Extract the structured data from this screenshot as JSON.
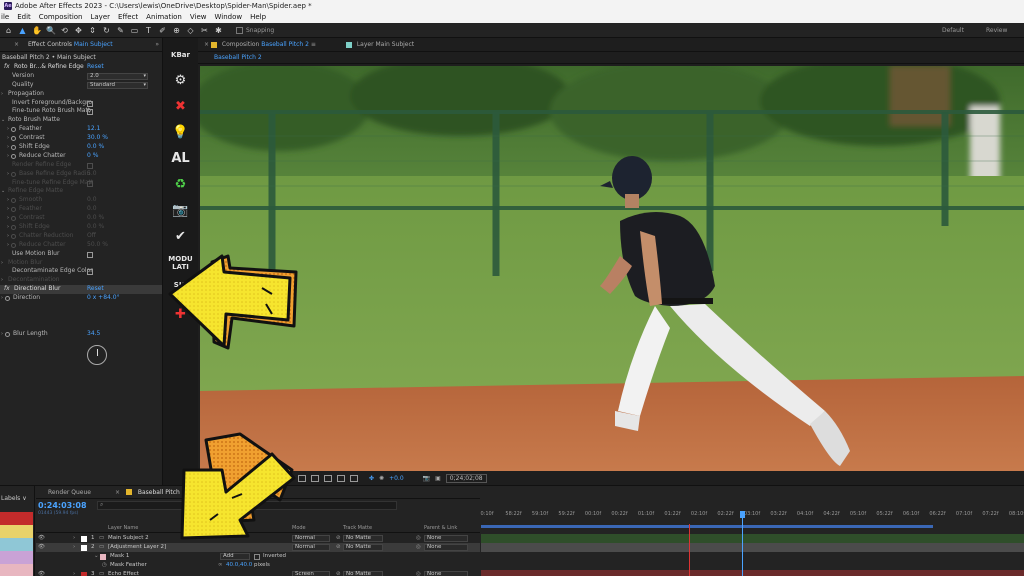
{
  "app": {
    "title": "Adobe After Effects 2023 - C:\\Users\\lewis\\OneDrive\\Desktop\\Spider-Man\\Spider.aep *",
    "logo": "Ae"
  },
  "menu": [
    "ile",
    "Edit",
    "Composition",
    "Layer",
    "Effect",
    "Animation",
    "View",
    "Window",
    "Help"
  ],
  "toolbar": {
    "tools": [
      "home-icon",
      "selection-arrow-icon",
      "hand-icon",
      "zoom-icon",
      "orbit-icon",
      "pan-icon",
      "dolly-icon",
      "rotate-icon",
      "pen-icon",
      "shape-icon",
      "type-icon",
      "brush-icon",
      "clone-stamp-icon",
      "eraser-icon",
      "roto-brush-icon",
      "puppet-pin-icon"
    ],
    "tool_glyphs": [
      "⌂",
      "▲",
      "✋",
      "🔍",
      "⟲",
      "✥",
      "⇕",
      "↻",
      "✎",
      "▭",
      "T",
      "✐",
      "⊕",
      "◇",
      "✂",
      "✱"
    ],
    "snapping_label": "Snapping",
    "workspaces": [
      "Default",
      "Review"
    ]
  },
  "effect_controls": {
    "tab_prefix": "Effect Controls",
    "tab_subject": "Main Subject",
    "subtitle": "Baseball Pitch 2 • Main Subject",
    "rows": [
      {
        "type": "fx",
        "label": "Roto Br...& Refine Edge",
        "reset": "Reset"
      },
      {
        "type": "dropdown",
        "indent": 12,
        "label": "Version",
        "value": "2.0"
      },
      {
        "type": "dropdown",
        "indent": 12,
        "label": "Quality",
        "value": "Standard"
      },
      {
        "type": "group",
        "indent": 6,
        "label": "Propagation"
      },
      {
        "type": "check",
        "indent": 12,
        "label": "Invert Foreground/Backgro",
        "checked": false
      },
      {
        "type": "check",
        "indent": 12,
        "label": "Fine-tune Roto Brush Matt",
        "checked": true
      },
      {
        "type": "group-open",
        "indent": 6,
        "label": "Roto Brush Matte"
      },
      {
        "type": "param",
        "indent": 18,
        "label": "Feather",
        "value": "12.1"
      },
      {
        "type": "param",
        "indent": 18,
        "label": "Contrast",
        "value": "30.0 %"
      },
      {
        "type": "param",
        "indent": 18,
        "label": "Shift Edge",
        "value": "0.0 %"
      },
      {
        "type": "param",
        "indent": 18,
        "label": "Reduce Chatter",
        "value": "0 %"
      },
      {
        "type": "check",
        "indent": 12,
        "label": "Render Refine Edge",
        "checked": false,
        "dim": true
      },
      {
        "type": "param",
        "indent": 18,
        "label": "Base Refine Edge Radiu",
        "value": "5.0",
        "dim": true
      },
      {
        "type": "check",
        "indent": 12,
        "label": "Fine-tune Refine Edge Matt",
        "checked": true,
        "dim": true
      },
      {
        "type": "group-open",
        "indent": 6,
        "label": "Refine Edge Matte",
        "dim": true
      },
      {
        "type": "param",
        "indent": 18,
        "label": "Smooth",
        "value": "0.0",
        "dim": true
      },
      {
        "type": "param",
        "indent": 18,
        "label": "Feather",
        "value": "0.0",
        "dim": true
      },
      {
        "type": "param",
        "indent": 18,
        "label": "Contrast",
        "value": "0.0 %",
        "dim": true
      },
      {
        "type": "param",
        "indent": 18,
        "label": "Shift Edge",
        "value": "0.0 %",
        "dim": true
      },
      {
        "type": "param",
        "indent": 18,
        "label": "Chatter Reduction",
        "value": "Off",
        "dim": true
      },
      {
        "type": "param",
        "indent": 18,
        "label": "Reduce Chatter",
        "value": "50.0 %",
        "dim": true
      },
      {
        "type": "check",
        "indent": 12,
        "label": "Use Motion Blur",
        "checked": false
      },
      {
        "type": "group",
        "indent": 6,
        "label": "Motion Blur",
        "dim": true
      },
      {
        "type": "check",
        "indent": 12,
        "label": "Decontaminate Edge Color",
        "checked": false
      },
      {
        "type": "group",
        "indent": 6,
        "label": "Decontamination",
        "dim": true
      },
      {
        "type": "fx-hl",
        "label": "Directional Blur",
        "reset": "Reset"
      },
      {
        "type": "param",
        "indent": 12,
        "label": "Direction",
        "value": "0 x +84.0°"
      },
      {
        "type": "spacer"
      },
      {
        "type": "spacer"
      },
      {
        "type": "spacer"
      },
      {
        "type": "param",
        "indent": 12,
        "label": "Blur Length",
        "value": "34.5"
      }
    ]
  },
  "plugins": [
    {
      "name": "kbar-button",
      "label": "KBar",
      "kind": "txt"
    },
    {
      "name": "settings-gear-icon",
      "label": "⚙",
      "kind": "big"
    },
    {
      "name": "red-arrows-plugin-icon",
      "label": "✖",
      "kind": "red"
    },
    {
      "name": "lightbulb-icon",
      "label": "💡",
      "kind": "yellow"
    },
    {
      "name": "al-plugin-button",
      "label": "AL",
      "kind": "big"
    },
    {
      "name": "recycle-icon",
      "label": "♻",
      "kind": "green"
    },
    {
      "name": "camera-plugin-icon",
      "label": "📷",
      "kind": "pink"
    },
    {
      "name": "checkmark-icon",
      "label": "✔",
      "kind": "big"
    },
    {
      "name": "modulate-plugin-button",
      "label": "MODU\nLATI",
      "kind": "txt"
    },
    {
      "name": "signal-plugin-button",
      "label": "SIG\nNA",
      "kind": "txt"
    },
    {
      "name": "red-cross-plugin-icon",
      "label": "✚",
      "kind": "red"
    }
  ],
  "composition": {
    "tab_prefix": "Composition",
    "tab_name": "Baseball Pitch 2",
    "layer_tab_prefix": "Layer",
    "layer_tab_name": "Main Subject",
    "breadcrumb": "Baseball Pitch 2",
    "viewer_zoom": "+0.0",
    "viewer_timecode": "0;24;02;08"
  },
  "timeline": {
    "labels_title": "Labels ∨",
    "label_colors": [
      "#c22b2b",
      "#e8d26a",
      "#8fc7d6",
      "#c9a2d6",
      "#e8b6c0",
      "#a3c4a0"
    ],
    "tabs": [
      "Render Queue",
      "Baseball Pitch 2"
    ],
    "timecode": "0:24:03:08",
    "timecode_sub": "01443 (59.94 fps)",
    "headers": {
      "layer_name": "Layer Name",
      "mode": "Mode",
      "track_matte": "Track Matte",
      "parent": "Parent & Link"
    },
    "layers": [
      {
        "num": "1",
        "name": "Main Subject 2",
        "color": "#ffffff",
        "mode": "Normal",
        "matte": "No Matte",
        "parent": "None"
      },
      {
        "num": "2",
        "name": "[Adjustment Layer 2]",
        "color": "#ffffff",
        "mode": "Normal",
        "matte": "No Matte",
        "parent": "None",
        "selected": true
      },
      {
        "sub": "Mask 1",
        "color": "#e8b6c0",
        "mode_label": "Add",
        "inverted": "Inverted"
      },
      {
        "sub2": "Mask Feather",
        "value": "40.0,40.0",
        "unit": "pixels"
      },
      {
        "num": "3",
        "name": "Echo Effect",
        "color": "#c22b2b",
        "mode": "Screen",
        "matte": "No Matte",
        "parent": "None"
      }
    ],
    "ruler_ticks": [
      "0:10f",
      "58:22f",
      "59:10f",
      "59:22f",
      "00:10f",
      "00:22f",
      "01:10f",
      "01:22f",
      "02:10f",
      "02:22f",
      "03:10f",
      "03:22f",
      "04:10f",
      "04:22f",
      "05:10f",
      "05:22f",
      "06:10f",
      "06:22f",
      "07:10f",
      "07:22f",
      "08:10f"
    ]
  }
}
